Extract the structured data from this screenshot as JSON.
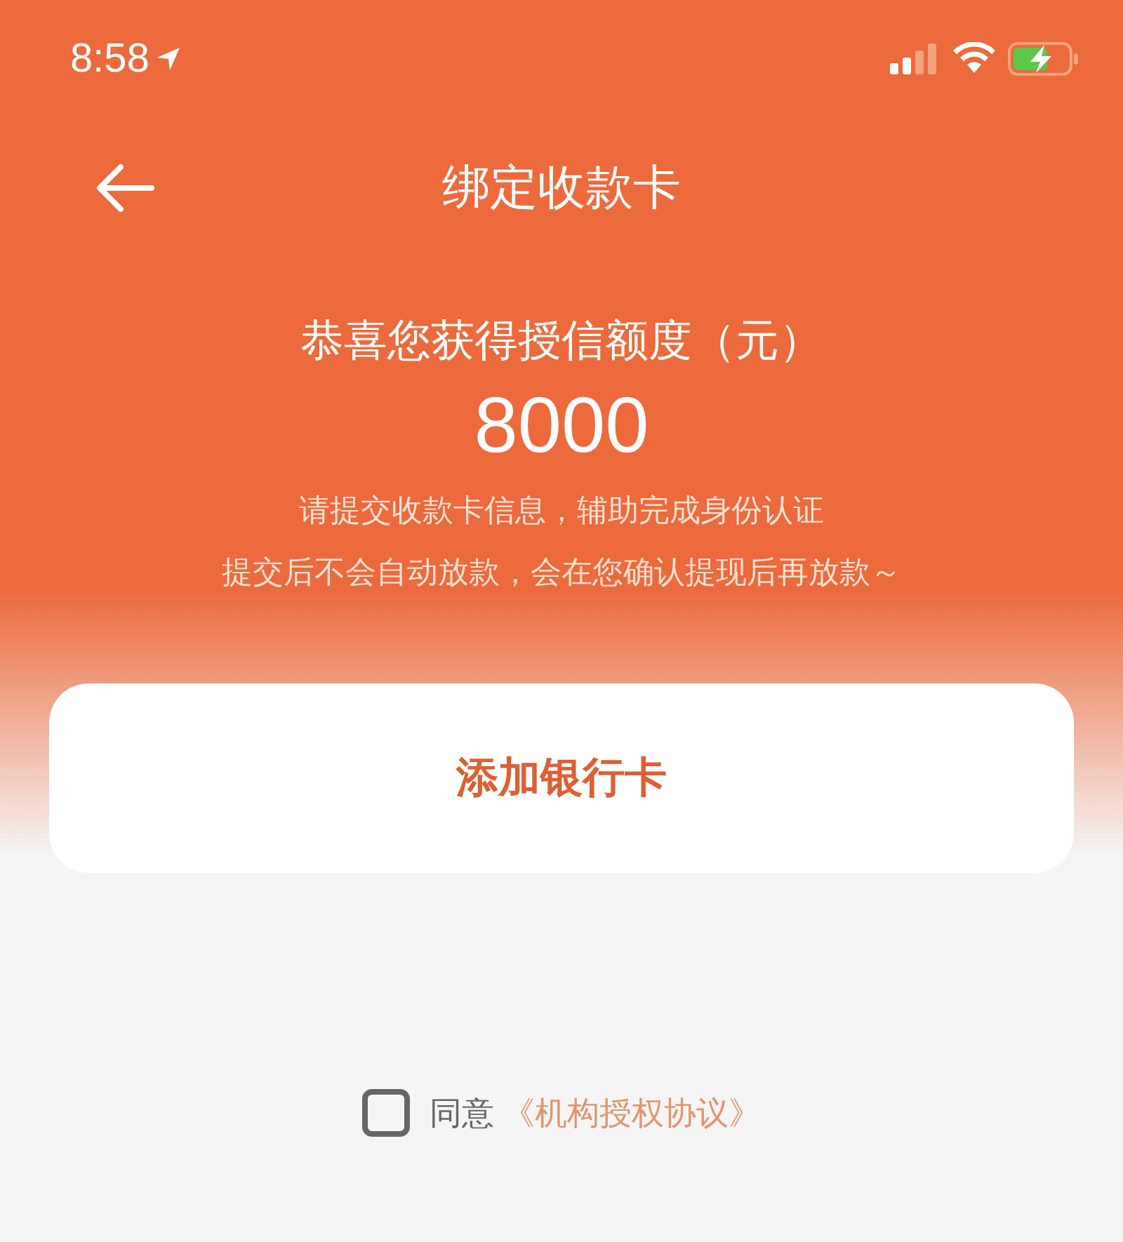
{
  "status_bar": {
    "time": "8:58"
  },
  "header": {
    "title": "绑定收款卡"
  },
  "credit": {
    "heading": "恭喜您获得授信额度（元）",
    "amount": "8000",
    "notes": [
      "请提交收款卡信息，辅助完成身份认证",
      "提交后不会自动放款，会在您确认提现后再放款～"
    ]
  },
  "add_card_button": {
    "label": "添加银行卡"
  },
  "agreement": {
    "checked": false,
    "text": "同意",
    "link": "《机构授权协议》"
  }
}
